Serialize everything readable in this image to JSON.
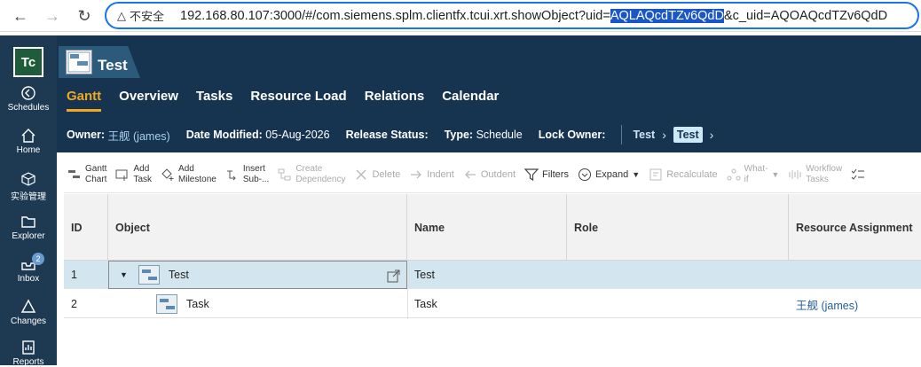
{
  "browser": {
    "security": "不安全",
    "url_prefix": "192.168.80.107:3000/#/com.siemens.splm.clientfx.tcui.xrt.showObject?uid=",
    "url_selected": "AQLAQcdTZv6QdD",
    "url_suffix": "&c_uid=AQOAQcdTZv6QdD"
  },
  "rail": {
    "logo": "Tc",
    "items": [
      {
        "label": "Schedules",
        "icon": "schedules-icon"
      },
      {
        "label": "Home",
        "icon": "home-icon"
      },
      {
        "label": "实验管理",
        "icon": "cube-icon"
      },
      {
        "label": "Explorer",
        "icon": "folder-icon"
      },
      {
        "label": "Inbox",
        "icon": "inbox-icon",
        "badge": "2"
      },
      {
        "label": "Changes",
        "icon": "changes-icon"
      },
      {
        "label": "Reports",
        "icon": "reports-icon"
      }
    ]
  },
  "header": {
    "title": "Test",
    "tabs": [
      "Gantt",
      "Overview",
      "Tasks",
      "Resource Load",
      "Relations",
      "Calendar"
    ],
    "info": {
      "owner_label": "Owner:",
      "owner_value": "王舰 (james)",
      "date_label": "Date Modified:",
      "date_value": "05-Aug-2026",
      "release_label": "Release Status:",
      "type_label": "Type:",
      "type_value": "Schedule",
      "lock_label": "Lock Owner:",
      "crumb1": "Test",
      "crumb2": "Test"
    }
  },
  "toolbar": {
    "gantt": [
      "Gantt",
      "Chart"
    ],
    "add_task": [
      "Add",
      "Task"
    ],
    "add_milestone": [
      "Add",
      "Milestone"
    ],
    "insert_sub": [
      "Insert",
      "Sub-..."
    ],
    "create_dep": [
      "Create",
      "Dependency"
    ],
    "delete": "Delete",
    "indent": "Indent",
    "outdent": "Outdent",
    "filters": "Filters",
    "expand": "Expand",
    "recalculate": "Recalculate",
    "whatif": [
      "What-",
      "if"
    ],
    "workflow": [
      "Workflow",
      "Tasks"
    ]
  },
  "table": {
    "headers": [
      "ID",
      "Object",
      "Name",
      "Role",
      "Resource Assignment"
    ],
    "rows": [
      {
        "id": "1",
        "object": "Test",
        "name": "Test",
        "role": "",
        "resource": ""
      },
      {
        "id": "2",
        "object": "Task",
        "name": "Task",
        "role": "",
        "resource": "王舰 (james)"
      }
    ]
  }
}
